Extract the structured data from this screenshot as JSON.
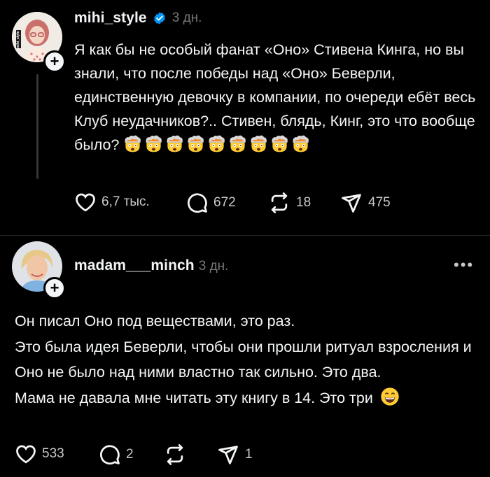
{
  "post": {
    "username": "mihi_style",
    "time": "3 дн.",
    "avatar_badge": "mihi_style",
    "text": "Я как бы не особый фанат «Оно» Стивена Кинга, но вы знали, что после победы над «Оно» Беверли, единственную девочку в компании, по очереди ебёт весь Клуб неудачников?.. Стивен, блядь, Кинг, это что вообще было?",
    "emoji_icon": "exploding-head-icon",
    "emoji_count": 9,
    "stats": {
      "likes": "6,7 тыс.",
      "comments": "672",
      "reposts": "18",
      "shares": "475"
    }
  },
  "reply": {
    "username": "madam___minch",
    "time": "3 дн.",
    "more": "•••",
    "lines": [
      "Он писал Оно под веществами, это раз.",
      "Это была идея Беверли, чтобы они прошли ритуал взросления и Оно не было над ними властно так сильно. Это два.",
      "Мама не давала мне читать эту книгу в 14. Это три"
    ],
    "trailing_emoji": "grinning-face-icon",
    "stats": {
      "likes": "533",
      "comments": "2",
      "reposts": "",
      "shares": "1"
    }
  },
  "colors": {
    "background": "#000000",
    "text": "#f3f5f7",
    "muted": "#777777",
    "verified": "#0095f6"
  }
}
